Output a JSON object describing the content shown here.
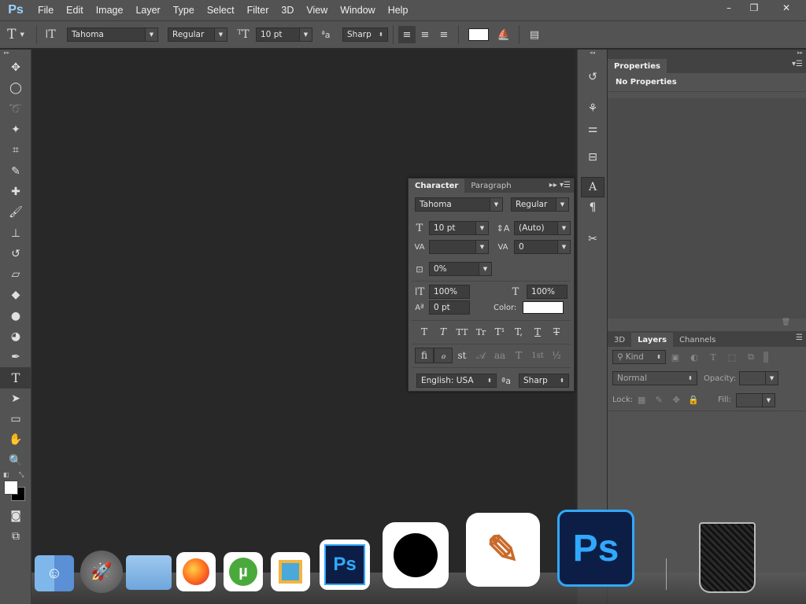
{
  "menubar": {
    "logo": "Ps",
    "items": [
      "File",
      "Edit",
      "Image",
      "Layer",
      "Type",
      "Select",
      "Filter",
      "3D",
      "View",
      "Window",
      "Help"
    ],
    "window_controls": [
      "–",
      "❐",
      "✕"
    ]
  },
  "options": {
    "font_family": "Tahoma",
    "font_style": "Regular",
    "font_size": "10 pt",
    "aa_label": "a",
    "antialias": "Sharp"
  },
  "properties": {
    "tab": "Properties",
    "message": "No Properties"
  },
  "character": {
    "tabs": [
      "Character",
      "Paragraph"
    ],
    "font_family": "Tahoma",
    "font_style": "Regular",
    "size": "10 pt",
    "leading": "(Auto)",
    "kerning": "",
    "tracking": "0",
    "tsume": "0%",
    "vscale": "100%",
    "hscale": "100%",
    "baseline": "0 pt",
    "color_label": "Color:",
    "color": "#ffffff",
    "style_glyphs": [
      "T",
      "T",
      "TT",
      "Tr",
      "T¹",
      "T,",
      "T",
      "T"
    ],
    "opentype_glyphs": [
      "fi",
      "ℴ",
      "st",
      "𝒜",
      "aa",
      "T",
      "1st",
      "½"
    ],
    "language": "English: USA",
    "antialias": "Sharp"
  },
  "layers": {
    "tabs": [
      "3D",
      "Layers",
      "Channels"
    ],
    "filter": "Kind",
    "blend_mode": "Normal",
    "opacity_label": "Opacity:",
    "lock_label": "Lock:",
    "fill_label": "Fill:"
  },
  "dock": {
    "apps": [
      "finder",
      "launchpad",
      "folder",
      "firefox",
      "utorrent",
      "sublime",
      "photoshop-small",
      "apple",
      "app-store",
      "photoshop-large",
      "trash"
    ],
    "ps_label": "Ps"
  },
  "colors": {
    "ui_panel": "#535353",
    "canvas": "#282828",
    "ps_blue": "#31a8ff"
  }
}
